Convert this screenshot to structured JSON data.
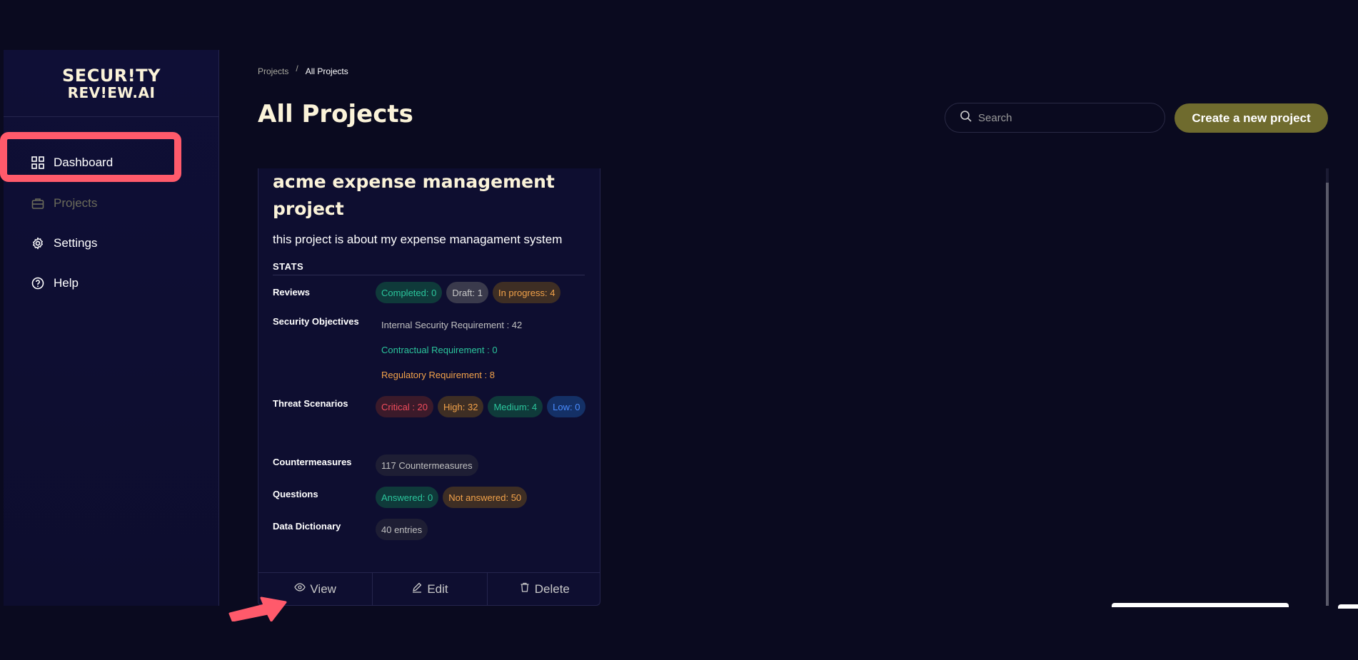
{
  "sidebar": {
    "logo_line1": "SECUR!TY",
    "logo_line2": "REV!EW.AI",
    "items": [
      {
        "label": "Dashboard",
        "icon": "grid-icon"
      },
      {
        "label": "Projects",
        "icon": "briefcase-icon",
        "active": true
      },
      {
        "label": "Settings",
        "icon": "gear-icon"
      },
      {
        "label": "Help",
        "icon": "help-icon"
      }
    ]
  },
  "breadcrumb": {
    "root": "Projects",
    "separator": "/",
    "current": "All Projects"
  },
  "header": {
    "title": "All Projects",
    "search_placeholder": "Search",
    "create_label": "Create a new project"
  },
  "project": {
    "title": "acme expense management project",
    "description": "this project is about my expense managament system",
    "stats_heading": "STATS",
    "rows": {
      "reviews": {
        "label": "Reviews",
        "completed": "Completed: 0",
        "draft": "Draft: 1",
        "in_progress": "In progress: 4"
      },
      "objectives": {
        "label": "Security Objectives",
        "internal": "Internal Security Requirement : 42",
        "contractual": "Contractual Requirement : 0",
        "regulatory": "Regulatory Requirement : 8"
      },
      "threats": {
        "label": "Threat Scenarios",
        "critical": "Critical : 20",
        "high": "High: 32",
        "medium": "Medium: 4",
        "low": "Low: 0"
      },
      "countermeasures": {
        "label": "Countermeasures",
        "count": "117 Countermeasures"
      },
      "questions": {
        "label": "Questions",
        "answered": "Answered: 0",
        "not_answered": "Not answered: 50"
      },
      "dictionary": {
        "label": "Data Dictionary",
        "entries": "40 entries"
      }
    },
    "actions": {
      "view": "View",
      "edit": "Edit",
      "delete": "Delete"
    }
  },
  "colors": {
    "background": "#0a0a1f",
    "accent": "#6f6b2e",
    "highlight": "#ff5a6b",
    "title_cream": "#fbf3d9"
  }
}
